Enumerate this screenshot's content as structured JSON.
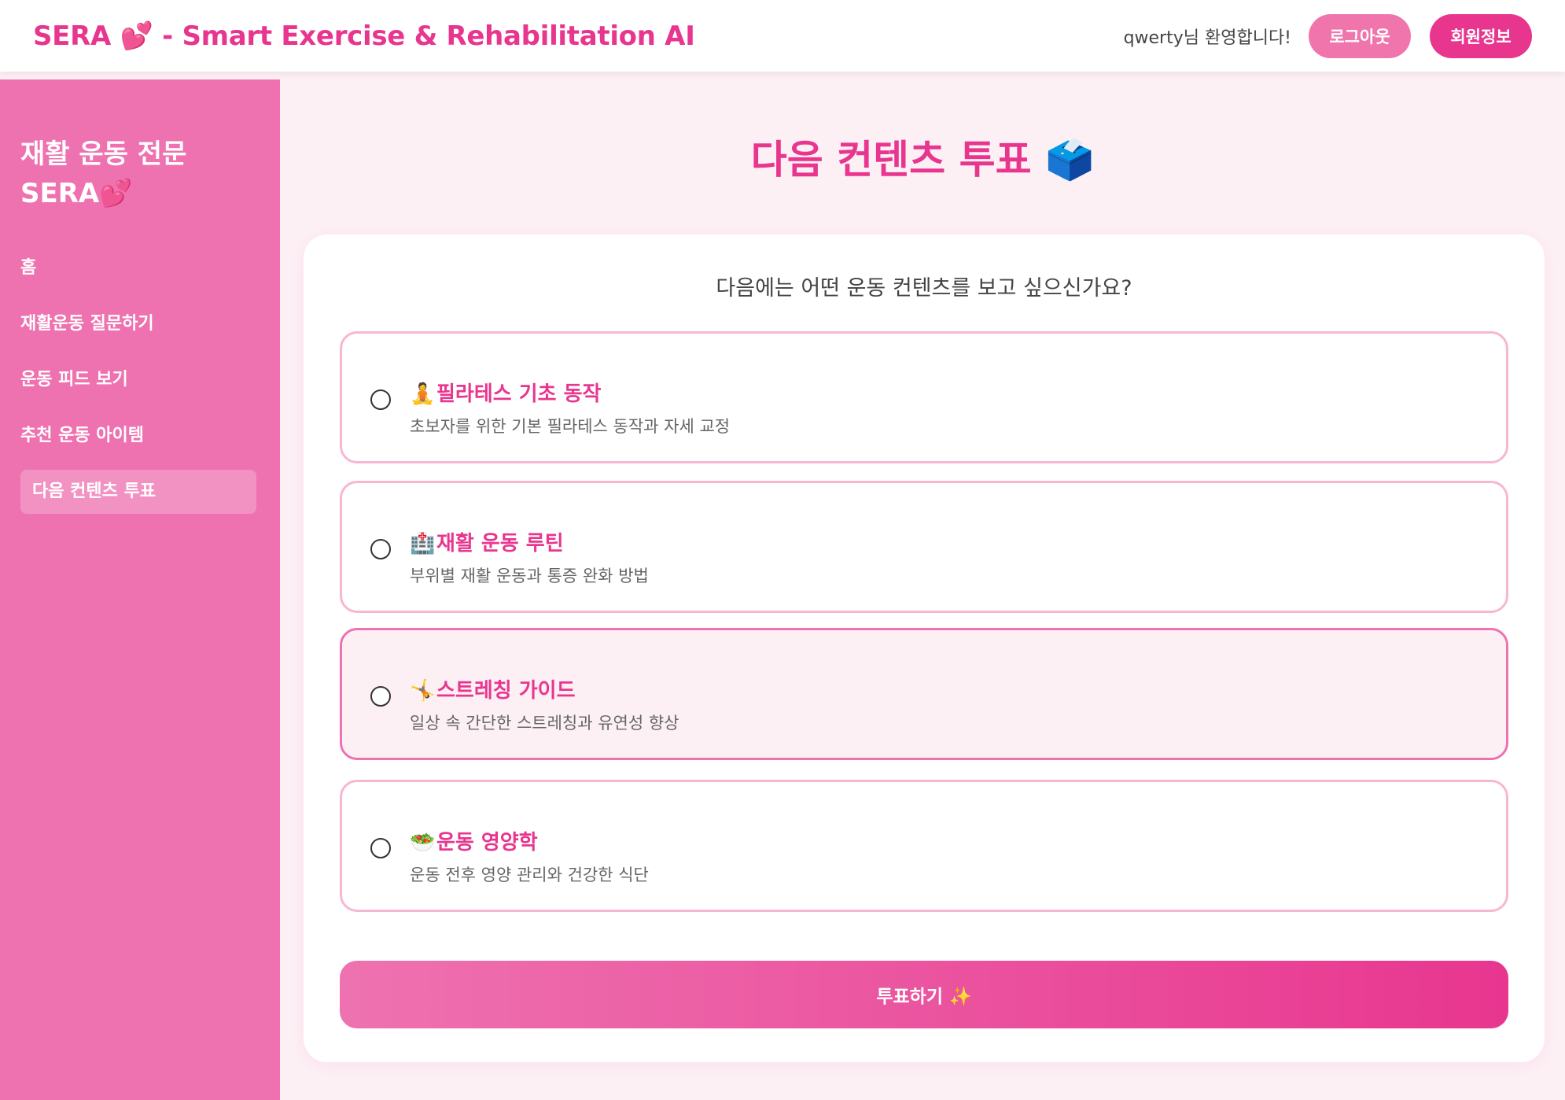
{
  "header": {
    "brand": "SERA 💕 - Smart Exercise & Rehabilitation AI",
    "welcome": "qwerty님 환영합니다!",
    "logout_label": "로그아웃",
    "member_info_label": "회원정보"
  },
  "sidebar": {
    "title_line1": "재활 운동 전문",
    "title_line2": "SERA💕",
    "items": [
      {
        "label": "홈"
      },
      {
        "label": "재활운동 질문하기"
      },
      {
        "label": "운동 피드 보기"
      },
      {
        "label": "추천 운동 아이템"
      },
      {
        "label": "다음 컨텐츠 투표"
      }
    ]
  },
  "main": {
    "page_title": "다음 컨텐츠 투표 🗳️",
    "question": "다음에는 어떤 운동 컨텐츠를 보고 싶으신가요?",
    "options": [
      {
        "icon": "🧘",
        "title": "필라테스 기초 동작",
        "description": "초보자를 위한 기본 필라테스 동작과 자세 교정"
      },
      {
        "icon": "🏥",
        "title": "재활 운동 루틴",
        "description": "부위별 재활 운동과 통증 완화 방법"
      },
      {
        "icon": "🤸",
        "title": "스트레칭 가이드",
        "description": "일상 속 간단한 스트레칭과 유연성 향상"
      },
      {
        "icon": "🥗",
        "title": "운동 영양학",
        "description": "운동 전후 영양 관리와 건강한 식단"
      }
    ],
    "vote_button": "투표하기 ✨"
  },
  "colors": {
    "accent": "#e8368f",
    "sidebar": "#ee72b0",
    "background": "#fdf0f5",
    "option_border": "#f7b7d3"
  }
}
